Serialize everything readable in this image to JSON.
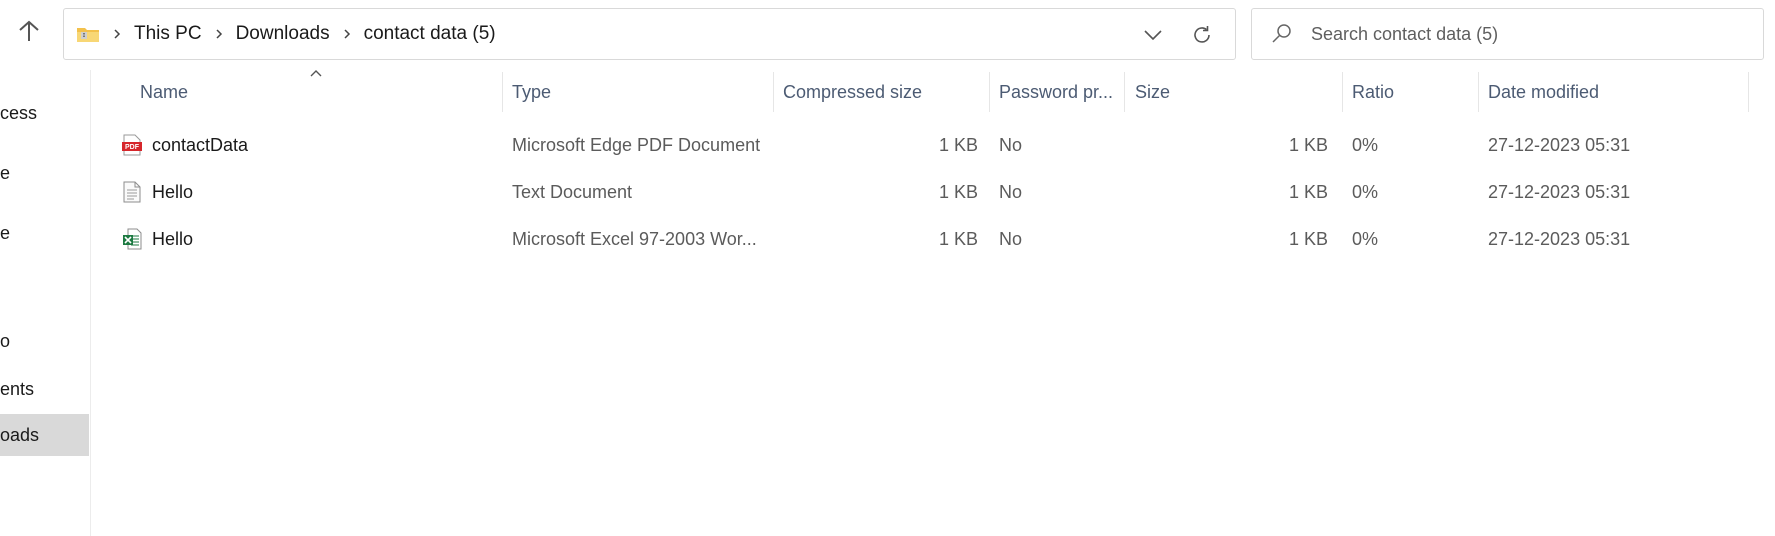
{
  "breadcrumb": [
    "This PC",
    "Downloads",
    "contact data (5)"
  ],
  "search": {
    "placeholder": "Search contact data (5)"
  },
  "nav": {
    "items": [
      "cess",
      "e",
      "e",
      "o",
      "ents",
      "oads"
    ],
    "selected": "oads"
  },
  "columns": {
    "name": "Name",
    "type": "Type",
    "compressed_size": "Compressed size",
    "password": "Password pr...",
    "size": "Size",
    "ratio": "Ratio",
    "date_modified": "Date modified",
    "sorted_by": "Name"
  },
  "files": [
    {
      "icon": "pdf-file-icon",
      "name": "contactData",
      "type": "Microsoft Edge PDF Document",
      "compressed": "1 KB",
      "password": "No",
      "size": "1 KB",
      "ratio": "0%",
      "date": "27-12-2023 05:31"
    },
    {
      "icon": "text-file-icon",
      "name": "Hello",
      "type": "Text Document",
      "compressed": "1 KB",
      "password": "No",
      "size": "1 KB",
      "ratio": "0%",
      "date": "27-12-2023 05:31"
    },
    {
      "icon": "excel-file-icon",
      "name": "Hello",
      "type": "Microsoft Excel 97-2003 Wor...",
      "compressed": "1 KB",
      "password": "No",
      "size": "1 KB",
      "ratio": "0%",
      "date": "27-12-2023 05:31"
    }
  ],
  "colors": {
    "header_text": "#4c5b73",
    "selected_nav": "#d9d9d9",
    "pdf": "#d6262b",
    "excel": "#1d7a42"
  }
}
